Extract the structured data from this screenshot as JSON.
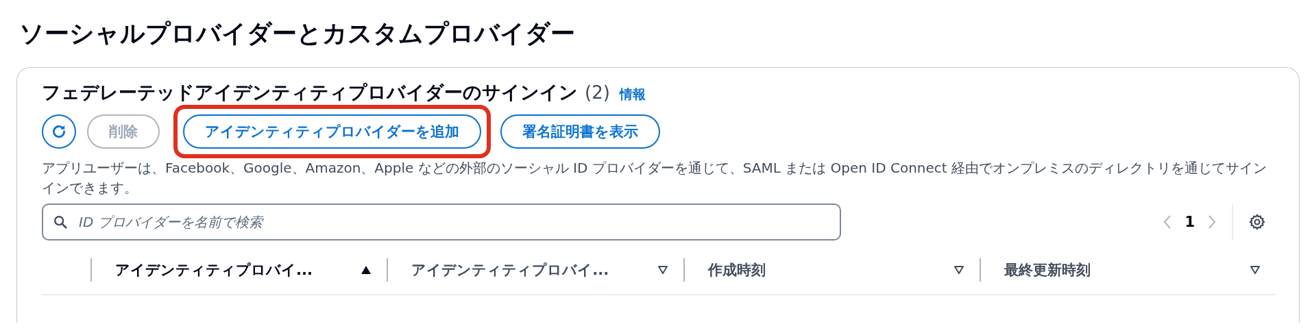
{
  "page_title": "ソーシャルプロバイダーとカスタムプロバイダー",
  "panel": {
    "heading": "フェデレーテッドアイデンティティプロバイダーのサインイン",
    "count": "(2)",
    "info_link": "情報",
    "actions": [
      {
        "kind": "refresh",
        "disabled": false,
        "highlighted": false
      },
      {
        "kind": "text",
        "label": "削除",
        "disabled": true,
        "highlighted": false
      },
      {
        "kind": "text",
        "label": "アイデンティティプロバイダーを追加",
        "disabled": false,
        "highlighted": true
      },
      {
        "kind": "text",
        "label": "署名証明書を表示",
        "disabled": false,
        "highlighted": false
      }
    ],
    "description": "アプリユーザーは、Facebook、Google、Amazon、Apple などの外部のソーシャル ID プロバイダーを通じて、SAML または Open ID Connect 経由でオンプレミスのディレクトリを通じてサインインできます。",
    "search": {
      "placeholder": "ID プロバイダーを名前で検索"
    },
    "pagination": {
      "page": "1",
      "prev_disabled": true,
      "next_disabled": true
    },
    "table": {
      "columns": [
        {
          "label": "アイデンティティプロバイ...",
          "sorted": true
        },
        {
          "label": "アイデンティティプロバイ...",
          "sorted": false
        },
        {
          "label": "作成時刻",
          "sorted": false
        },
        {
          "label": "最終更新時刻",
          "sorted": false
        }
      ]
    }
  }
}
